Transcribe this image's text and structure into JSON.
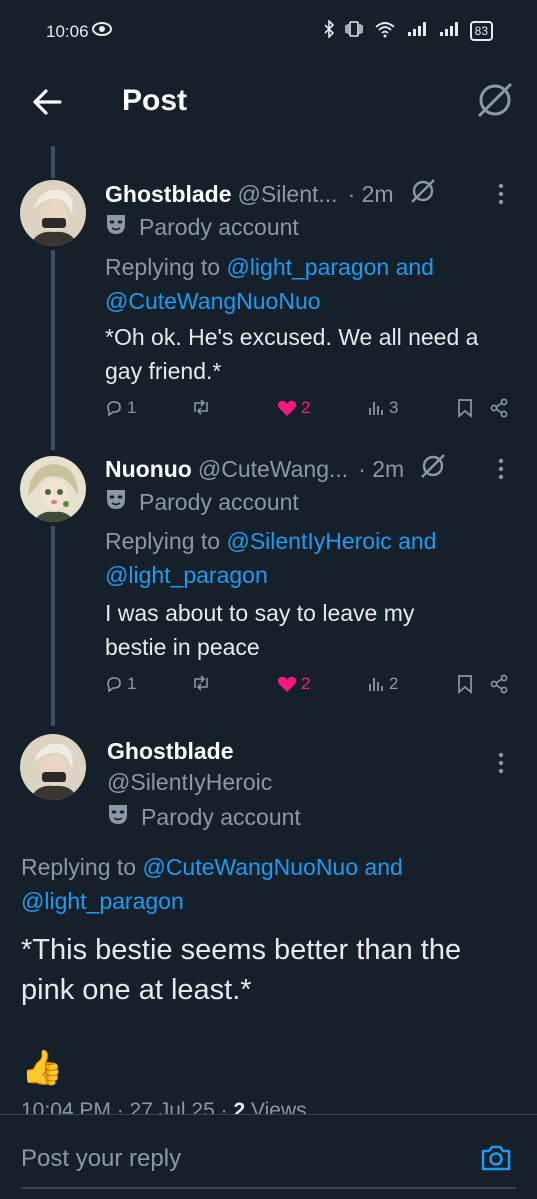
{
  "status_bar": {
    "time": "10:06",
    "battery": "83"
  },
  "header": {
    "title": "Post"
  },
  "replies": [
    {
      "name": "Ghostblade",
      "handle": "@Silent...",
      "time": "· 2m",
      "badge": "Parody account",
      "replying_prefix": "Replying to ",
      "replying_line1_link": "@light_paragon and",
      "replying_line2_link": "@CuteWangNuoNuo",
      "text_line1": "*Oh ok. He's excused. We all need a",
      "text_line2": "gay friend.*",
      "replies_count": "1",
      "likes_count": "2",
      "views_count": "3"
    },
    {
      "name": "Nuonuo",
      "handle": "@CuteWang...",
      "time": "· 2m",
      "badge": "Parody account",
      "replying_prefix": "Replying to ",
      "replying_line1_link": "@SilentIyHeroic and",
      "replying_line2_link": "@light_paragon",
      "text_line1": "I was about to say to leave my",
      "text_line2": "bestie in peace",
      "replies_count": "1",
      "likes_count": "2",
      "views_count": "2"
    }
  ],
  "main_post": {
    "name": "Ghostblade",
    "handle": "@SilentIyHeroic",
    "badge": "Parody account",
    "replying_prefix": "Replying to ",
    "replying_line1_link": "@CuteWangNuoNuo and",
    "replying_line2_link": "@light_paragon",
    "text_line1": "*This bestie seems better than the",
    "text_line2": "pink one at least.*",
    "emoji": "👍",
    "meta_time": "10:04 PM · 27 Jul 25 · ",
    "meta_views_count": "2",
    "meta_views_label": " Views"
  },
  "reply_bar": {
    "placeholder": "Post your reply"
  },
  "colors": {
    "background": "#15202b",
    "link": "#1d9bf0",
    "like": "#f91880",
    "muted": "#8b98a5"
  }
}
